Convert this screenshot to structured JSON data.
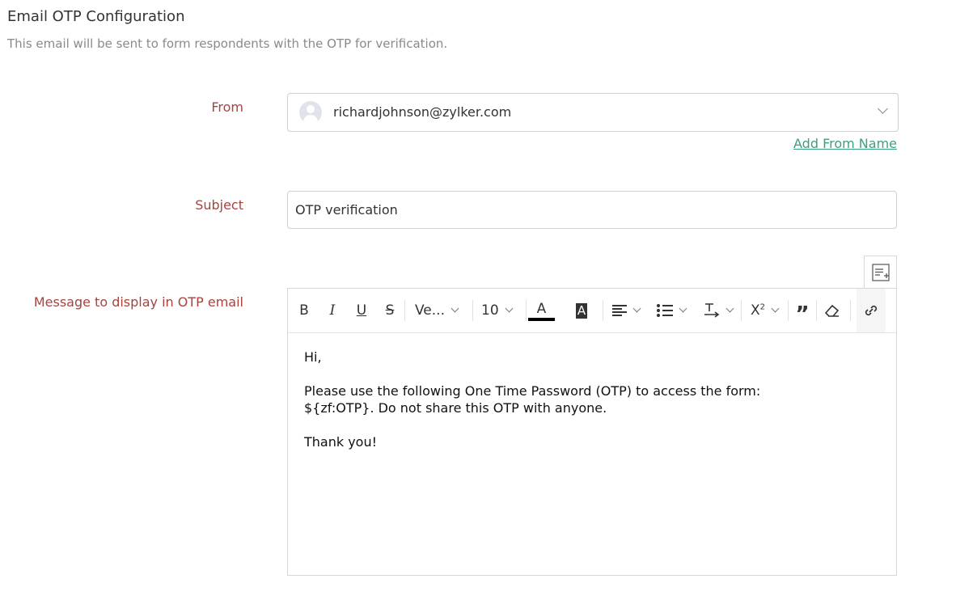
{
  "header": {
    "title": "Email OTP Configuration",
    "subtitle": "This email will be sent to form respondents with the OTP for verification."
  },
  "from": {
    "label": "From",
    "value": "richardjohnson@zylker.com",
    "add_from_name": "Add From Name"
  },
  "subject": {
    "label": "Subject",
    "value": "OTP verification"
  },
  "message": {
    "label": "Message to display in OTP email",
    "toolbar": {
      "font_family": "Ve...",
      "font_size": "10",
      "text_color": "#000000"
    },
    "body": [
      "Hi,",
      "Please use the following One Time Password (OTP) to access the form: ${zf:OTP}. Do not share this OTP with anyone.",
      "Thank you!"
    ]
  },
  "colors": {
    "label": "#a8423d",
    "link": "#3aa17e"
  }
}
